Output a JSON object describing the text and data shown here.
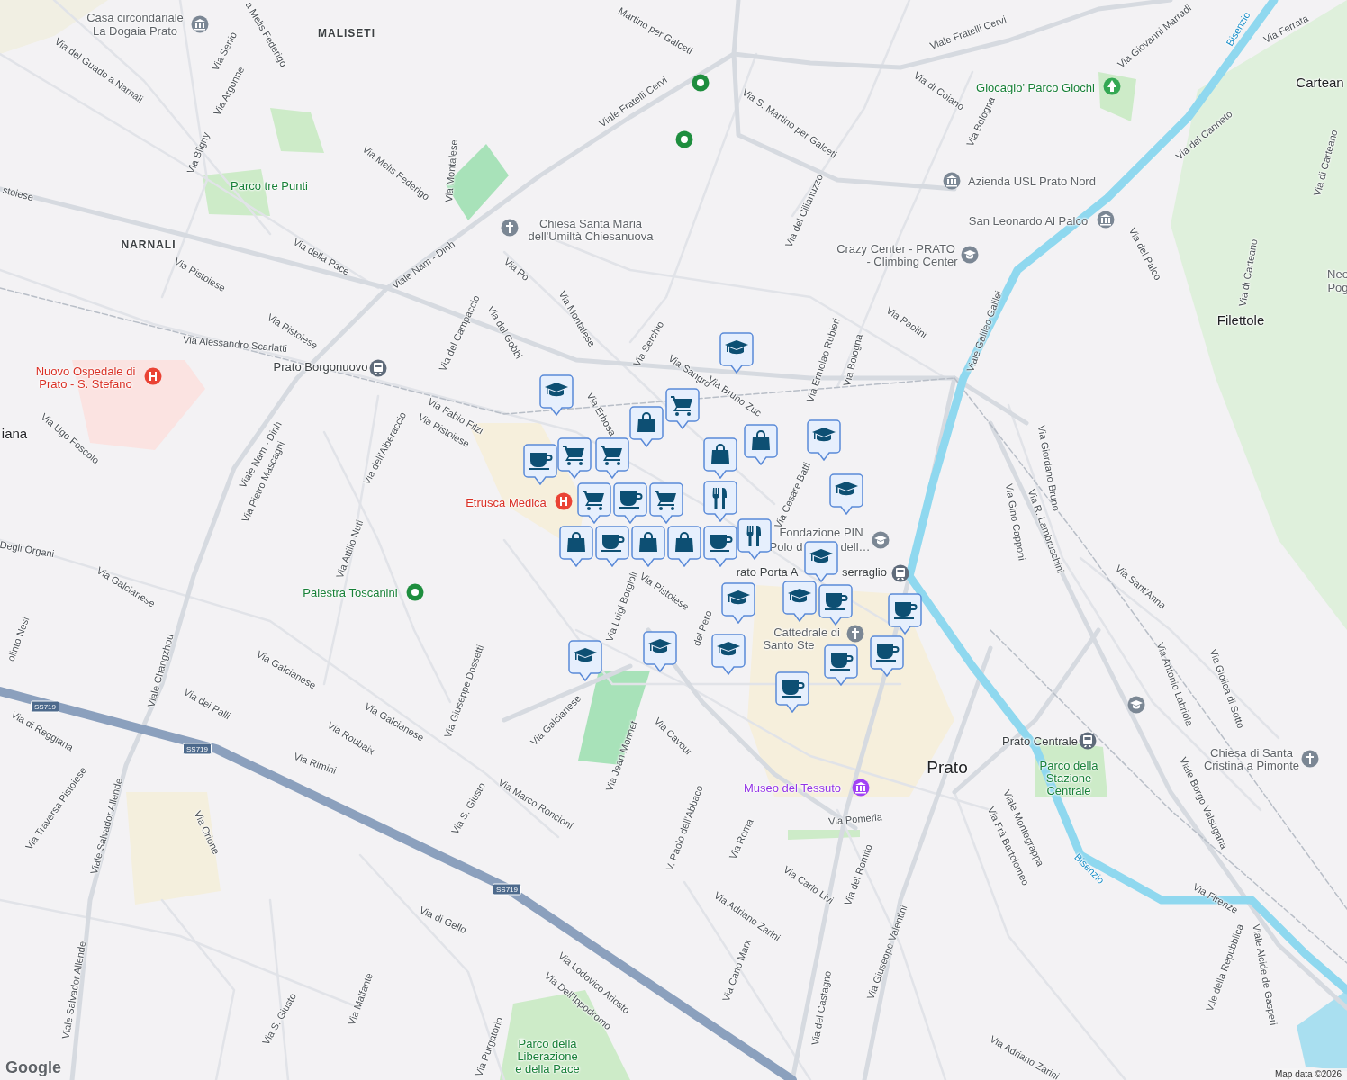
{
  "map": {
    "labels": [
      {
        "text": "Via del Guado a Narnali",
        "kind": "street"
      },
      {
        "text": "Via Senio",
        "kind": "street"
      },
      {
        "text": "Via Argonne",
        "kind": "street"
      },
      {
        "text": "a Melis Federigo",
        "kind": "street"
      },
      {
        "text": "Via Bligny",
        "kind": "street"
      },
      {
        "text": "Via Melis Federigo",
        "kind": "street"
      },
      {
        "text": "Via Montalese",
        "kind": "street"
      },
      {
        "text": "Viale Fratelli Cervi",
        "kind": "street"
      },
      {
        "text": "Martino per Galceti",
        "kind": "street"
      },
      {
        "text": "Via S. Martino per Galceti",
        "kind": "street"
      },
      {
        "text": "Viale Fratelli Cervi",
        "kind": "street"
      },
      {
        "text": "Via di Coiano",
        "kind": "street"
      },
      {
        "text": "Via Bologna",
        "kind": "street"
      },
      {
        "text": "Via Giovanni Marradi",
        "kind": "street"
      },
      {
        "text": "Via Ferrata",
        "kind": "street"
      },
      {
        "text": "Bisenzio",
        "kind": "river"
      },
      {
        "text": "Via del Cilianuzzo",
        "kind": "street"
      },
      {
        "text": "Via del Canneto",
        "kind": "street"
      },
      {
        "text": "Via di Carteano",
        "kind": "street"
      },
      {
        "text": "Via del Palco",
        "kind": "street"
      },
      {
        "text": "Via di Carteano",
        "kind": "street"
      },
      {
        "text": "stoiese",
        "kind": "street"
      },
      {
        "text": "Via della Pace",
        "kind": "street"
      },
      {
        "text": "Viale Nam - Dinh",
        "kind": "street"
      },
      {
        "text": "Via Pistoiese",
        "kind": "street"
      },
      {
        "text": "Via Pistoiese",
        "kind": "street"
      },
      {
        "text": "Via Alessandro Scarlatti",
        "kind": "street"
      },
      {
        "text": "Via del Campaccio",
        "kind": "street"
      },
      {
        "text": "Via Po",
        "kind": "street"
      },
      {
        "text": "Via del Gobbi",
        "kind": "street"
      },
      {
        "text": "Via Montalese",
        "kind": "street"
      },
      {
        "text": "Via Serchio",
        "kind": "street"
      },
      {
        "text": "Via Sangro",
        "kind": "street"
      },
      {
        "text": "Via Bruno Zuc",
        "kind": "street"
      },
      {
        "text": "Via Ermolao Rubieri",
        "kind": "street"
      },
      {
        "text": "Via Bologna",
        "kind": "street"
      },
      {
        "text": "Via Paolini",
        "kind": "street"
      },
      {
        "text": "Viale Galileo Galilei",
        "kind": "street"
      },
      {
        "text": "Via Fabio Filzi",
        "kind": "street"
      },
      {
        "text": "Via Pistoiese",
        "kind": "street"
      },
      {
        "text": "Via Erbosa",
        "kind": "street"
      },
      {
        "text": "Via Ugo Foscolo",
        "kind": "street"
      },
      {
        "text": "Viale Nam - Dinh",
        "kind": "street"
      },
      {
        "text": "Via Pietro Mascagni",
        "kind": "street"
      },
      {
        "text": "Via dell'Alberaccio",
        "kind": "street"
      },
      {
        "text": "Via Cesare Batti",
        "kind": "street"
      },
      {
        "text": "Via Giordano Bruno",
        "kind": "street"
      },
      {
        "text": "Via Gino Capponi",
        "kind": "street"
      },
      {
        "text": "Via R. Lambruschini",
        "kind": "street"
      },
      {
        "text": "Via Attilio Nuti",
        "kind": "street"
      },
      {
        "text": "Degli Organi",
        "kind": "street"
      },
      {
        "text": "Via Galcianese",
        "kind": "street"
      },
      {
        "text": "Via Luigi Borgioli",
        "kind": "street"
      },
      {
        "text": "Via Pistoiese",
        "kind": "street"
      },
      {
        "text": "del Pero",
        "kind": "street"
      },
      {
        "text": "Via Sant'Anna",
        "kind": "street"
      },
      {
        "text": "olinto Nesi",
        "kind": "street"
      },
      {
        "text": "Viale Changzhou",
        "kind": "street"
      },
      {
        "text": "Via Galcianese",
        "kind": "street"
      },
      {
        "text": "Via Antonio Labriola",
        "kind": "street"
      },
      {
        "text": "Via Giolica di Sotto",
        "kind": "street"
      },
      {
        "text": "Via Giuseppe Dossetti",
        "kind": "street"
      },
      {
        "text": "Via dei Palli",
        "kind": "street"
      },
      {
        "text": "Via Galcianese",
        "kind": "street"
      },
      {
        "text": "Via Galcianese",
        "kind": "street"
      },
      {
        "text": "Via di Reggiana",
        "kind": "street"
      },
      {
        "text": "Via Roubaix",
        "kind": "street"
      },
      {
        "text": "Via Rimini",
        "kind": "street"
      },
      {
        "text": "Via Jean Monnet",
        "kind": "street"
      },
      {
        "text": "Via Cavour",
        "kind": "street"
      },
      {
        "text": "Viale Borgo Valsugana",
        "kind": "street"
      },
      {
        "text": "Via S. Giusto",
        "kind": "street"
      },
      {
        "text": "Via Marco Roncioni",
        "kind": "street"
      },
      {
        "text": "Via Traversa Pistoiese",
        "kind": "street"
      },
      {
        "text": "Viale Salvador Allende",
        "kind": "street"
      },
      {
        "text": "Via Orione",
        "kind": "street"
      },
      {
        "text": "V. Paolo dell'Abbaco",
        "kind": "street"
      },
      {
        "text": "Via Roma",
        "kind": "street"
      },
      {
        "text": "Via Pomeria",
        "kind": "street"
      },
      {
        "text": "Viale Montegrappa",
        "kind": "street"
      },
      {
        "text": "Via Frà Bartolomeo",
        "kind": "street"
      },
      {
        "text": "Bisenzio",
        "kind": "river"
      },
      {
        "text": "Via del Romito",
        "kind": "street"
      },
      {
        "text": "Via Carlo Livi",
        "kind": "street"
      },
      {
        "text": "Via Firenze",
        "kind": "street"
      },
      {
        "text": "Via Adriano Zarini",
        "kind": "street"
      },
      {
        "text": "Via di Gello",
        "kind": "street"
      },
      {
        "text": "Via Giuseppe Valentini",
        "kind": "street"
      },
      {
        "text": "V.le della Repubblica",
        "kind": "street"
      },
      {
        "text": "Viale Alcide de Gasperi",
        "kind": "street"
      },
      {
        "text": "Via Lodovico Ariosto",
        "kind": "street"
      },
      {
        "text": "Via Dell'Ippodromo",
        "kind": "street"
      },
      {
        "text": "Via Carlo Marx",
        "kind": "street"
      },
      {
        "text": "Viale Salvador Allende",
        "kind": "street"
      },
      {
        "text": "Via Malfante",
        "kind": "street"
      },
      {
        "text": "Via S. Giusto",
        "kind": "street"
      },
      {
        "text": "Via del Castagno",
        "kind": "street"
      },
      {
        "text": "Via Purgatorio",
        "kind": "street"
      },
      {
        "text": "Via Adriano Zarini",
        "kind": "street"
      },
      {
        "text": "MALISETI",
        "kind": "place"
      },
      {
        "text": "NARNALI",
        "kind": "place"
      },
      {
        "text": "Prato",
        "kind": "city"
      },
      {
        "text": "Filettole",
        "kind": "town"
      },
      {
        "text": "Cartean",
        "kind": "town"
      },
      {
        "text": "iana",
        "kind": "town"
      },
      {
        "text": "Neo",
        "kind": "poi"
      },
      {
        "text": "Pog",
        "kind": "poi"
      },
      {
        "text": "Casa circondariale",
        "kind": "poi"
      },
      {
        "text": "La Dogaia Prato",
        "kind": "poi"
      },
      {
        "text": "Parco tre Punti",
        "kind": "park"
      },
      {
        "text": "Chiesa Santa Maria",
        "kind": "poi"
      },
      {
        "text": "dell'Umiltà Chiesanuova",
        "kind": "poi"
      },
      {
        "text": "Giocagio' Parco Giochi",
        "kind": "park"
      },
      {
        "text": "Azienda USL Prato Nord",
        "kind": "poi"
      },
      {
        "text": "San Leonardo Al Palco",
        "kind": "poi"
      },
      {
        "text": "Crazy Center - PRATO",
        "kind": "poi"
      },
      {
        "text": "- Climbing Center",
        "kind": "poi"
      },
      {
        "text": "Nuovo Ospedale di",
        "kind": "medical"
      },
      {
        "text": "Prato - S. Stefano",
        "kind": "medical"
      },
      {
        "text": "Prato Borgonuovo",
        "kind": "transit"
      },
      {
        "text": "Etrusca Medica",
        "kind": "medical"
      },
      {
        "text": "Palestra Toscanini",
        "kind": "park"
      },
      {
        "text": "Fondazione PIN",
        "kind": "poi"
      },
      {
        "text": "Polo d",
        "kind": "poi"
      },
      {
        "text": "dell…",
        "kind": "poi"
      },
      {
        "text": "rato Porta A",
        "kind": "transit"
      },
      {
        "text": "serraglio",
        "kind": "transit"
      },
      {
        "text": "Cattedrale di",
        "kind": "poi"
      },
      {
        "text": "Santo Ste",
        "kind": "poi"
      },
      {
        "text": "Prato Centrale",
        "kind": "transit"
      },
      {
        "text": "Parco della",
        "kind": "park"
      },
      {
        "text": "Stazione",
        "kind": "park"
      },
      {
        "text": "Centrale",
        "kind": "park"
      },
      {
        "text": "Chiesa di Santa",
        "kind": "poi"
      },
      {
        "text": "Cristina a Pimonte",
        "kind": "poi"
      },
      {
        "text": "Museo del Tessuto",
        "kind": "museum"
      },
      {
        "text": "Parco della",
        "kind": "park"
      },
      {
        "text": "Liberazione",
        "kind": "park"
      },
      {
        "text": "e della Pace",
        "kind": "park"
      }
    ],
    "road_shields": [
      {
        "text": "SS719"
      },
      {
        "text": "SS719"
      },
      {
        "text": "SS719"
      }
    ],
    "logo": "Google",
    "attribution": "Map data ©2026"
  }
}
